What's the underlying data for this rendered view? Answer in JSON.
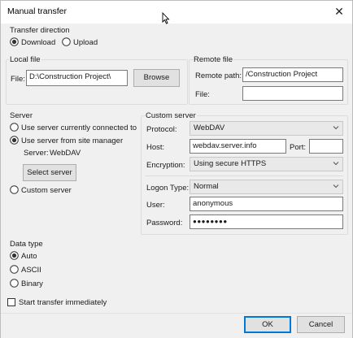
{
  "window": {
    "title": "Manual transfer",
    "close_glyph": "✕"
  },
  "transfer_direction": {
    "label": "Transfer direction",
    "download": "Download",
    "upload": "Upload",
    "selected": "Download"
  },
  "local_file": {
    "label": "Local file",
    "file_label": "File:",
    "file_value": "D:\\Construction Project\\",
    "browse": "Browse"
  },
  "remote_file": {
    "label": "Remote file",
    "path_label": "Remote path:",
    "path_value": "/Construction Project",
    "file_label": "File:",
    "file_value": ""
  },
  "server": {
    "label": "Server",
    "opt_current": "Use server currently connected to",
    "opt_site_manager": "Use server from site manager",
    "server_label": "Server:",
    "server_value": "WebDAV",
    "select_server": "Select server",
    "opt_custom": "Custom server",
    "selected": "Use server from site manager"
  },
  "custom_server": {
    "label": "Custom server",
    "protocol_label": "Protocol:",
    "protocol_value": "WebDAV",
    "host_label": "Host:",
    "host_value": "webdav.server.info",
    "port_label": "Port:",
    "port_value": "",
    "encryption_label": "Encryption:",
    "encryption_value": "Using secure HTTPS",
    "logon_label": "Logon Type:",
    "logon_value": "Normal",
    "user_label": "User:",
    "user_value": "anonymous",
    "password_label": "Password:",
    "password_value": "●●●●●●●●"
  },
  "data_type": {
    "label": "Data type",
    "auto": "Auto",
    "ascii": "ASCII",
    "binary": "Binary",
    "selected": "Auto"
  },
  "start_immediately": {
    "label": "Start transfer immediately",
    "checked": false
  },
  "buttons": {
    "ok": "OK",
    "cancel": "Cancel"
  },
  "colors": {
    "accent": "#0078d7",
    "window_bg": "#f0f0f0",
    "border": "#dcdcdc"
  }
}
